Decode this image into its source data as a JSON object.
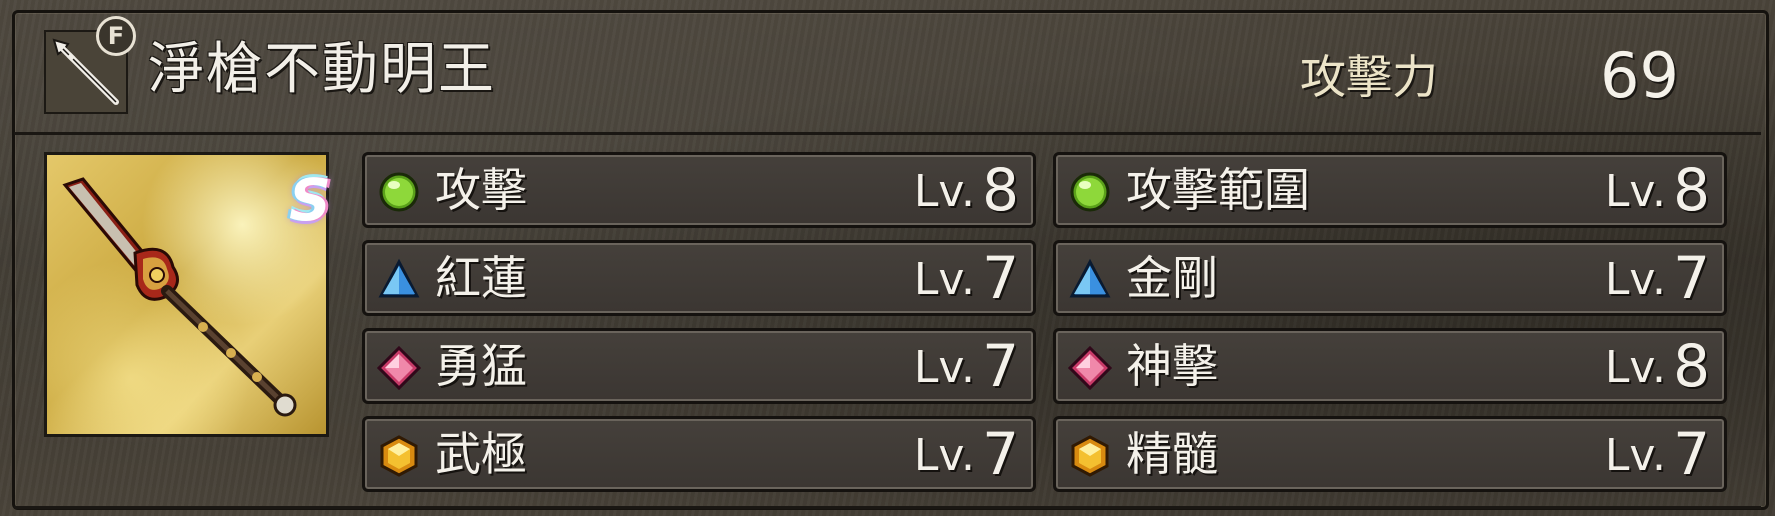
{
  "weapon": {
    "type_icon": "lance-icon",
    "favorite_badge": "F",
    "name": "淨槍不動明王",
    "rarity": "S",
    "image_icon": "spear-weapon-image"
  },
  "stats": {
    "attack_label": "攻擊力",
    "attack_value": "69"
  },
  "skills": [
    {
      "name": "攻擊",
      "level_prefix": "Lv.",
      "level": "8",
      "gem": "green-orb-icon"
    },
    {
      "name": "攻擊範圍",
      "level_prefix": "Lv.",
      "level": "8",
      "gem": "green-orb-icon"
    },
    {
      "name": "紅蓮",
      "level_prefix": "Lv.",
      "level": "7",
      "gem": "blue-pyramid-icon"
    },
    {
      "name": "金剛",
      "level_prefix": "Lv.",
      "level": "7",
      "gem": "blue-pyramid-icon"
    },
    {
      "name": "勇猛",
      "level_prefix": "Lv.",
      "level": "7",
      "gem": "pink-diamond-icon"
    },
    {
      "name": "神擊",
      "level_prefix": "Lv.",
      "level": "8",
      "gem": "pink-diamond-icon"
    },
    {
      "name": "武極",
      "level_prefix": "Lv.",
      "level": "7",
      "gem": "gold-hexagon-icon"
    },
    {
      "name": "精髓",
      "level_prefix": "Lv.",
      "level": "7",
      "gem": "gold-hexagon-icon"
    }
  ],
  "colors": {
    "green_gem": "#7cc82a",
    "blue_gem": "#4aa8e8",
    "pink_gem": "#e8608a",
    "gold_gem": "#e8a418"
  }
}
